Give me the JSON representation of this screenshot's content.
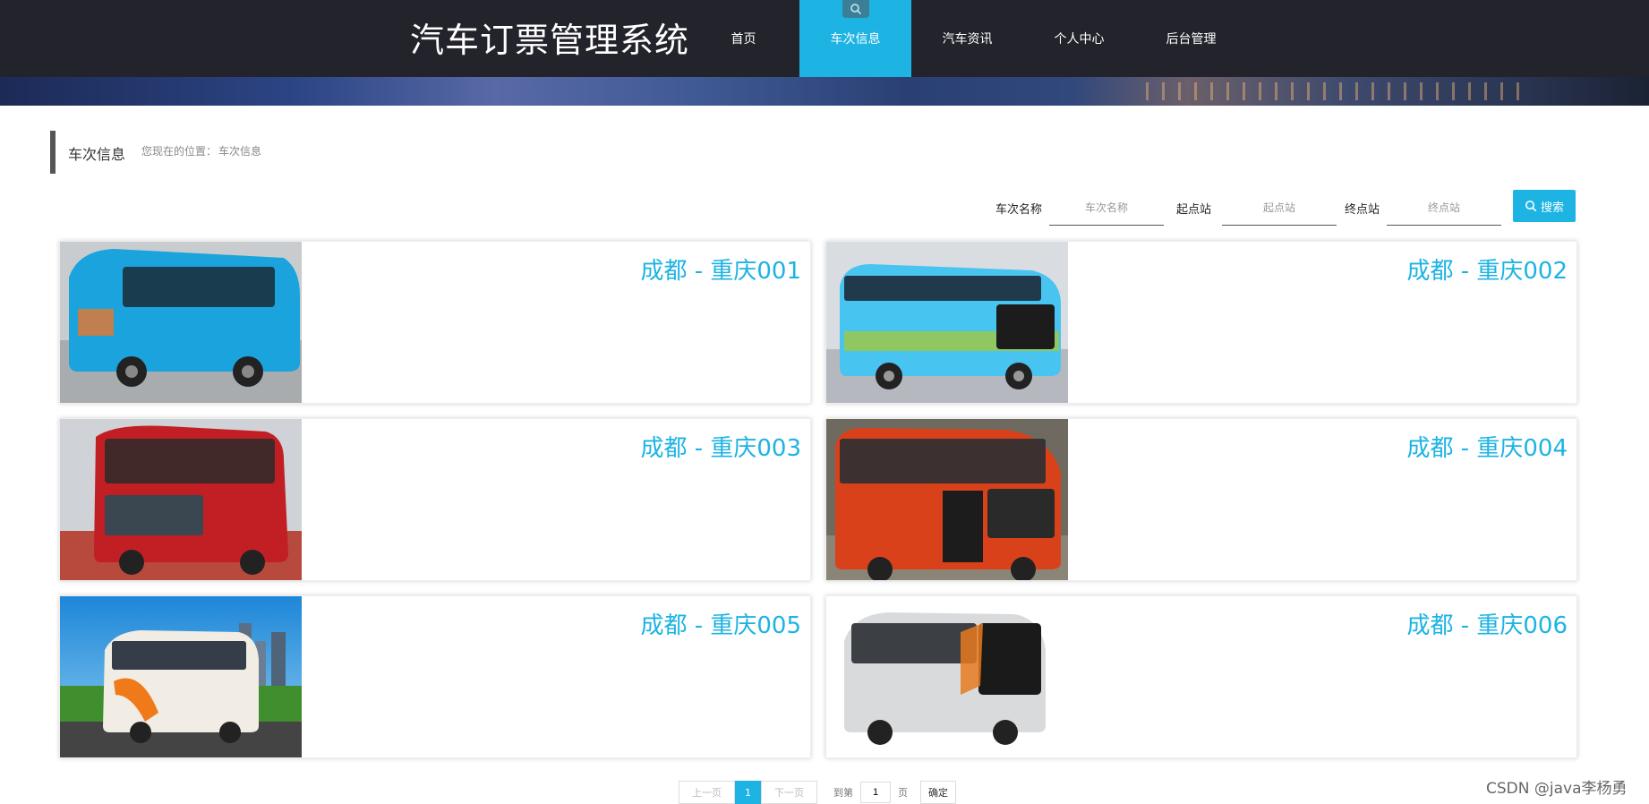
{
  "header": {
    "site_title": "汽车订票管理系统",
    "nav": [
      {
        "label": "首页",
        "active": false
      },
      {
        "label": "车次信息",
        "active": true
      },
      {
        "label": "汽车资讯",
        "active": false
      },
      {
        "label": "个人中心",
        "active": false
      },
      {
        "label": "后台管理",
        "active": false
      }
    ]
  },
  "breadcrumb": {
    "title": "车次信息",
    "prefix": "您现在的位置：",
    "current": "车次信息"
  },
  "search": {
    "fields": [
      {
        "label": "车次名称",
        "placeholder": "车次名称",
        "value": ""
      },
      {
        "label": "起点站",
        "placeholder": "起点站",
        "value": ""
      },
      {
        "label": "终点站",
        "placeholder": "终点站",
        "value": ""
      }
    ],
    "button_label": "搜索"
  },
  "trips": [
    {
      "title": "成都 - 重庆001",
      "bus_color": "#1aa3dc"
    },
    {
      "title": "成都 - 重庆002",
      "bus_color": "#48c4f0"
    },
    {
      "title": "成都 - 重庆003",
      "bus_color": "#c21f24"
    },
    {
      "title": "成都 - 重庆004",
      "bus_color": "#d9411a"
    },
    {
      "title": "成都 - 重庆005",
      "bus_color": "#f1ece4"
    },
    {
      "title": "成都 - 重庆006",
      "bus_color": "#d8dadc"
    }
  ],
  "pagination": {
    "prev": "上一页",
    "current_page": "1",
    "next": "下一页",
    "goto_prefix": "到第",
    "goto_value": "1",
    "goto_suffix": "页",
    "confirm": "确定"
  },
  "watermark": "CSDN @java李杨勇",
  "colors": {
    "accent": "#1db3e3",
    "header_bg": "#22232b"
  }
}
